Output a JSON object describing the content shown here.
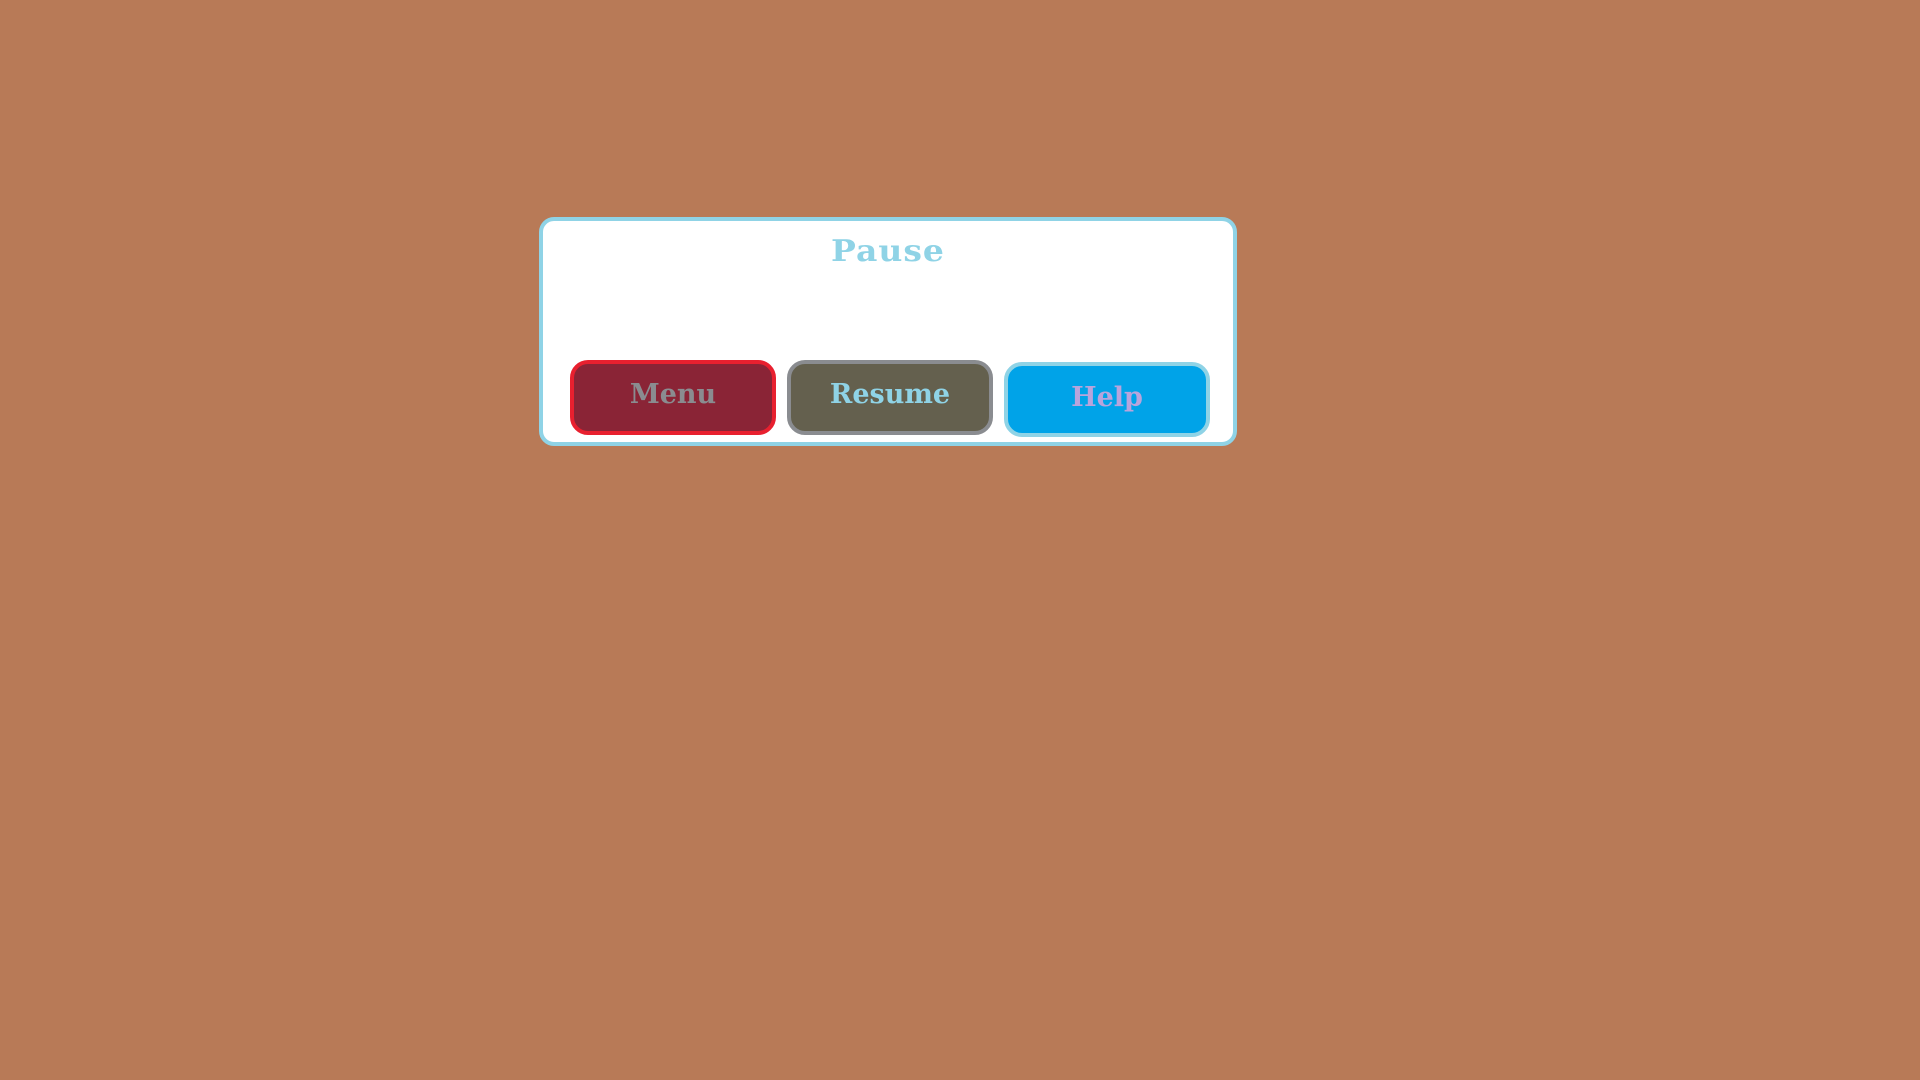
{
  "pause_dialog": {
    "title": "Pause",
    "buttons": {
      "menu_label": "Menu",
      "resume_label": "Resume",
      "help_label": "Help"
    }
  },
  "colors": {
    "background": "#b87a57",
    "dialog_border": "#8fd3e6",
    "menu_fill": "#8a2436",
    "menu_border": "#e8202f",
    "resume_fill": "#64604e",
    "help_fill": "#00a3e8"
  }
}
